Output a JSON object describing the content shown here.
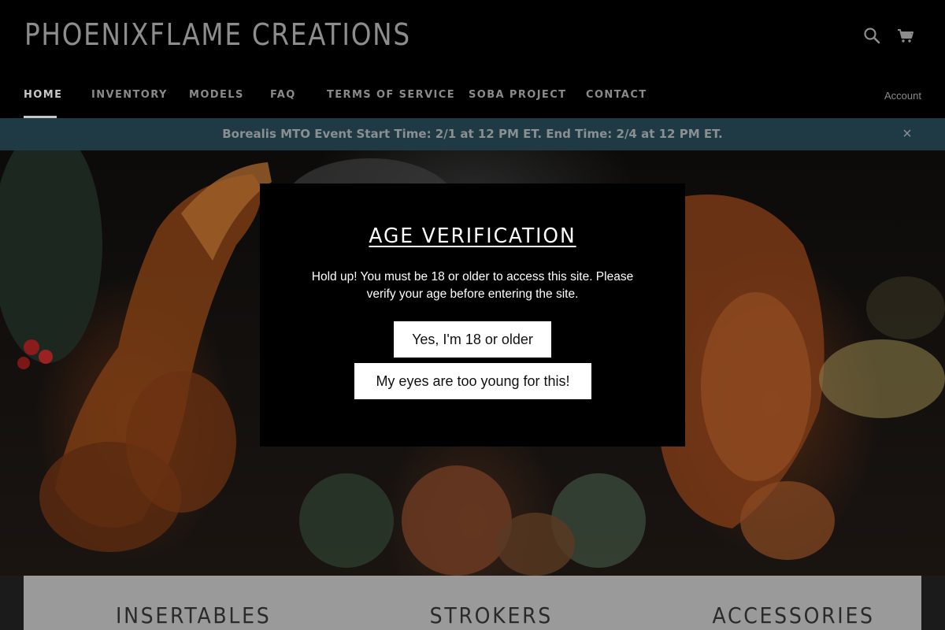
{
  "header": {
    "logo": "PHOENIXFLAME CREATIONS",
    "search_icon": "search-icon",
    "cart_icon": "cart-icon"
  },
  "nav": {
    "items": [
      {
        "label": "HOME",
        "active": true
      },
      {
        "label": "INVENTORY"
      },
      {
        "label": "MODELS"
      },
      {
        "label": "FAQ"
      },
      {
        "label": "TERMS OF SERVICE"
      },
      {
        "label": "SOBA PROJECT"
      },
      {
        "label": "CONTACT"
      }
    ],
    "account": "Account"
  },
  "announcement": {
    "text": "Borealis MTO Event Start Time: 2/1 at 12 PM ET. End Time: 2/4 at 12 PM ET.",
    "close_icon": "close-icon",
    "close_glyph": "×"
  },
  "age_modal": {
    "title": "AGE VERIFICATION",
    "message": "Hold up! You must be 18 or older to access this site. Please verify your age before entering the site.",
    "confirm": "Yes, I'm 18 or older",
    "decline": "My eyes are too young for this!"
  },
  "categories": [
    "INSERTABLES",
    "STROKERS",
    "ACCESSORIES"
  ],
  "colors": {
    "background": "#000000",
    "announcement_bg": "#1f3a45",
    "nav_text": "#8a8a8a",
    "button_bg": "#ffffff"
  }
}
